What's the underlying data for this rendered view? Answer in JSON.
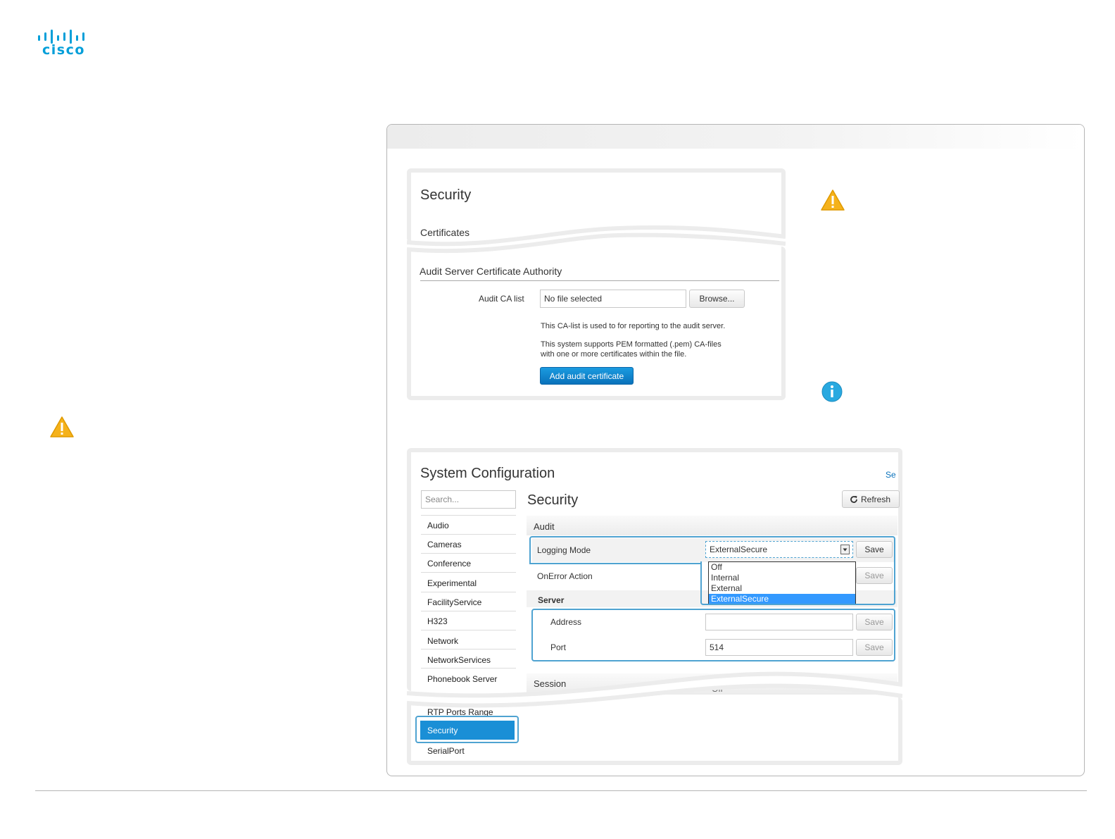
{
  "logo": {
    "text": "cisco",
    "color": "#049fd9"
  },
  "security_panel": {
    "title": "Security",
    "tab": "Certificates",
    "section_title": "Audit Server Certificate Authority",
    "field_label": "Audit CA list",
    "file_value": "No file selected",
    "browse_label": "Browse...",
    "help_1": "This CA-list is used to for reporting to the audit server.",
    "help_2": "This system supports PEM formatted (.pem) CA-files",
    "help_3": "with one or more certificates within the file.",
    "add_button": "Add audit certificate"
  },
  "system_config": {
    "title": "System Configuration",
    "top_link": "Se",
    "search_placeholder": "Search...",
    "nav_items": [
      "Audio",
      "Cameras",
      "Conference",
      "Experimental",
      "FacilityService",
      "H323",
      "Network",
      "NetworkServices",
      "Phonebook Server"
    ],
    "nav_items_lower": [
      "RTP Ports Range",
      "Security",
      "SerialPort"
    ],
    "selected_nav": "Security",
    "section_title": "Security",
    "refresh_label": "Refresh",
    "audit_heading": "Audit",
    "logging_mode_label": "Logging Mode",
    "logging_mode_value": "ExternalSecure",
    "logging_mode_options": [
      "Off",
      "Internal",
      "External",
      "ExternalSecure"
    ],
    "onerror_label": "OnError Action",
    "server_heading": "Server",
    "address_label": "Address",
    "address_value": "",
    "port_label": "Port",
    "port_value": "514",
    "save_label": "Save",
    "session_heading": "Session",
    "session_value": "Off"
  },
  "colors": {
    "accent_blue": "#0a72bb",
    "highlight": "#4fa3d1",
    "warning": "#f5b21b",
    "info": "#29a9e0"
  },
  "icons": [
    "warning-icon",
    "info-icon",
    "refresh-icon",
    "dropdown-arrow-icon"
  ]
}
